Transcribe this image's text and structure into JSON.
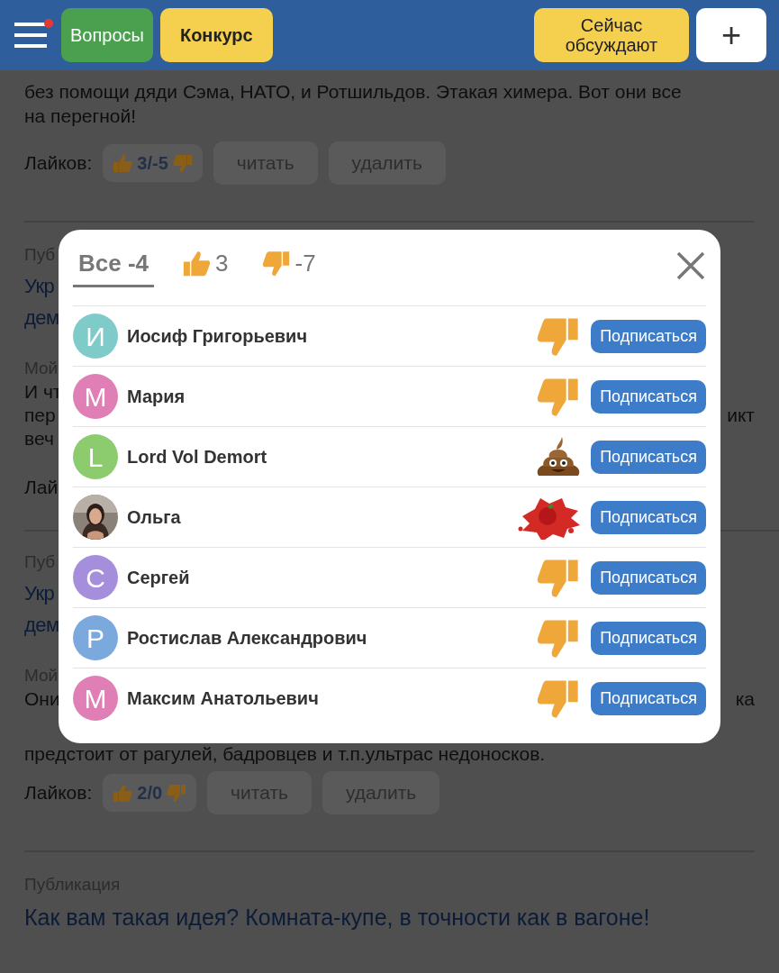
{
  "header": {
    "menu_badge": true,
    "buttons": [
      {
        "label": "Вопросы",
        "kind": "green"
      },
      {
        "label": "Конкурс",
        "kind": "yellow-bold"
      }
    ],
    "right_buttons": [
      {
        "label": "Сейчас обсуждают",
        "kind": "yellow"
      },
      {
        "label": "+",
        "kind": "white"
      }
    ]
  },
  "top_post": {
    "lines": [
      "без помощи дяди Сэма, НАТО, и Ротшильдов. Этакая химера. Вот они все",
      "на перегной!"
    ],
    "likes_label": "Лайков:",
    "likes": "3/-5",
    "read": "читать",
    "delete": "удалить"
  },
  "hidden_fragments": [
    {
      "kind": "label",
      "left": "Пуб"
    },
    {
      "kind": "title",
      "left": "Укр"
    },
    {
      "kind": "title",
      "left": "дем"
    },
    {
      "kind": "label",
      "left": "Мой"
    },
    {
      "kind": "text",
      "left": "И чт"
    },
    {
      "kind": "text",
      "left": "пер",
      "right": "икт"
    },
    {
      "kind": "text",
      "left": "веч"
    },
    {
      "kind": "likes",
      "left": "Лай"
    },
    {
      "kind": "divider"
    },
    {
      "kind": "label",
      "left": "Пуб"
    },
    {
      "kind": "title",
      "left": "Укр"
    },
    {
      "kind": "title",
      "left": "дем"
    },
    {
      "kind": "label",
      "left": "Мой"
    },
    {
      "kind": "text",
      "left": "Они",
      "right": "ка"
    }
  ],
  "second_post": {
    "lines": [
      "предстоит от рагулей, бадровцев и т.п.ультрас недоносков."
    ],
    "likes_label": "Лайков:",
    "likes": "2/0",
    "read": "читать",
    "delete": "удалить"
  },
  "third_post": {
    "label": "Публикация",
    "title": "Как вам такая идея? Комната-купе, в точности как в вагоне!"
  },
  "modal": {
    "tabs": [
      {
        "kind": "all",
        "label": "Все -4",
        "selected": true
      },
      {
        "kind": "like",
        "label": "3",
        "selected": false
      },
      {
        "kind": "dislike",
        "label": "-7",
        "selected": false
      }
    ],
    "users": [
      {
        "kind": "dislike",
        "avatar": {
          "kind": "letter",
          "letter": "И",
          "color": "#7fcbc9"
        },
        "name": "Иосиф Григорьевич",
        "button": "Подписаться"
      },
      {
        "kind": "dislike",
        "avatar": {
          "kind": "letter",
          "letter": "М",
          "color": "#e07fb5"
        },
        "name": "Мария",
        "button": "Подписаться"
      },
      {
        "kind": "poo",
        "avatar": {
          "kind": "letter",
          "letter": "L",
          "color": "#8ccc6e"
        },
        "name": "Lord Vol Demort",
        "button": "Подписаться"
      },
      {
        "kind": "tomato",
        "name": "Ольга",
        "button": "Подписаться"
      },
      {
        "kind": "dislike",
        "avatar": {
          "kind": "letter",
          "letter": "С",
          "color": "#a58fdc"
        },
        "name": "Сергей",
        "button": "Подписаться"
      },
      {
        "kind": "dislike",
        "avatar": {
          "kind": "letter",
          "letter": "Р",
          "color": "#7ba9dd"
        },
        "name": "Ростислав Александрович",
        "button": "Подписаться"
      },
      {
        "kind": "dislike",
        "avatar": {
          "kind": "letter",
          "letter": "М",
          "color": "#e07fb5"
        },
        "name": "Максим Анатольевич",
        "button": "Подписаться"
      }
    ]
  }
}
